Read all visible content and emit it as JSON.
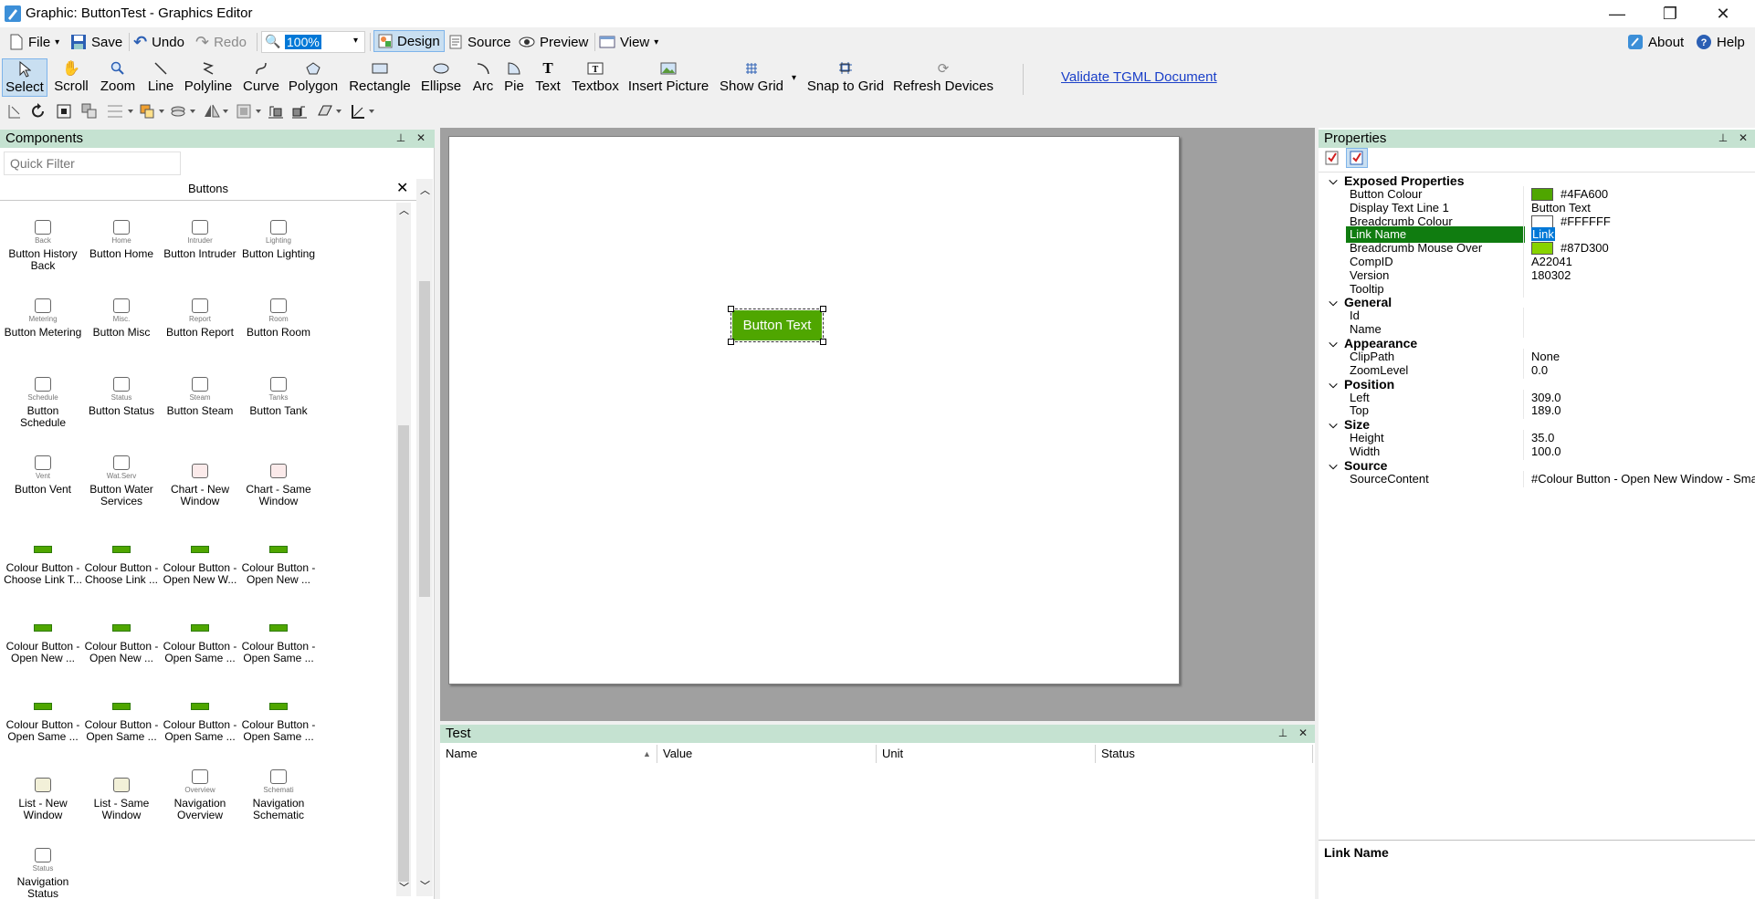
{
  "app": {
    "window_title": "Graphic: ButtonTest - Graphics Editor",
    "controls": {
      "minimize": "—",
      "restore": "❐",
      "close": "✕"
    }
  },
  "menu": {
    "file": "File",
    "save": "Save",
    "undo": "Undo",
    "redo": "Redo",
    "zoom_value": "100%",
    "design": "Design",
    "source": "Source",
    "preview": "Preview",
    "view": "View",
    "about": "About",
    "help": "Help"
  },
  "tools": {
    "select": "Select",
    "scroll": "Scroll",
    "zoom": "Zoom",
    "line": "Line",
    "polyline": "Polyline",
    "curve": "Curve",
    "polygon": "Polygon",
    "rectangle": "Rectangle",
    "ellipse": "Ellipse",
    "arc": "Arc",
    "pie": "Pie",
    "text": "Text",
    "textbox": "Textbox",
    "insert_picture": "Insert Picture",
    "show_grid": "Show Grid",
    "snap_to_grid": "Snap to Grid",
    "refresh_devices": "Refresh Devices",
    "validate_link": "Validate TGML Document"
  },
  "components": {
    "title": "Components",
    "filter_placeholder": "Quick Filter",
    "group_title": "Buttons",
    "items": [
      {
        "label": "Button History Back",
        "caption": "Back",
        "icon": "back-arrow-icon"
      },
      {
        "label": "Button Home",
        "caption": "Home",
        "icon": "home-icon"
      },
      {
        "label": "Button Intruder",
        "caption": "Intruder",
        "icon": "intruder-icon"
      },
      {
        "label": "Button Lighting",
        "caption": "Lighting",
        "icon": "bulb-icon"
      },
      {
        "label": "Button Metering",
        "caption": "Metering",
        "icon": "meter-icon"
      },
      {
        "label": "Button Misc",
        "caption": "Misc.",
        "icon": "folder-icon"
      },
      {
        "label": "Button Report",
        "caption": "Report",
        "icon": "report-icon"
      },
      {
        "label": "Button Room",
        "caption": "Room",
        "icon": "room-icon"
      },
      {
        "label": "Button Schedule",
        "caption": "Schedule",
        "icon": "schedule-icon"
      },
      {
        "label": "Button Status",
        "caption": "Status",
        "icon": "status-icon"
      },
      {
        "label": "Button Steam",
        "caption": "Steam",
        "icon": "steam-icon"
      },
      {
        "label": "Button Tank",
        "caption": "Tanks",
        "icon": "tank-icon"
      },
      {
        "label": "Button Vent",
        "caption": "Vent",
        "icon": "fan-icon"
      },
      {
        "label": "Button Water Services",
        "caption": "Wat.Serv",
        "icon": "tap-icon"
      },
      {
        "label": "Chart - New Window",
        "caption": "",
        "icon": "chart-icon"
      },
      {
        "label": "Chart - Same Window",
        "caption": "",
        "icon": "chart-icon"
      },
      {
        "label": "Colour Button - Choose Link T...",
        "caption": "",
        "icon": "mini-button-icon"
      },
      {
        "label": "Colour Button - Choose Link ...",
        "caption": "",
        "icon": "mini-button-icon"
      },
      {
        "label": "Colour Button - Open New W...",
        "caption": "",
        "icon": "mini-button-icon"
      },
      {
        "label": "Colour Button - Open New ...",
        "caption": "",
        "icon": "mini-button-icon"
      },
      {
        "label": "Colour Button - Open New ...",
        "caption": "",
        "icon": "mini-button-icon"
      },
      {
        "label": "Colour Button - Open New ...",
        "caption": "",
        "icon": "mini-button-icon"
      },
      {
        "label": "Colour Button - Open Same ...",
        "caption": "",
        "icon": "mini-button-icon"
      },
      {
        "label": "Colour Button - Open Same ...",
        "caption": "",
        "icon": "mini-button-icon"
      },
      {
        "label": "Colour Button - Open Same ...",
        "caption": "",
        "icon": "mini-button-icon"
      },
      {
        "label": "Colour Button - Open Same ...",
        "caption": "",
        "icon": "mini-button-icon"
      },
      {
        "label": "Colour Button - Open Same ...",
        "caption": "",
        "icon": "mini-button-icon"
      },
      {
        "label": "Colour Button - Open Same ...",
        "caption": "",
        "icon": "mini-button-icon"
      },
      {
        "label": "List - New Window",
        "caption": "",
        "icon": "list-icon"
      },
      {
        "label": "List - Same Window",
        "caption": "",
        "icon": "list-icon"
      },
      {
        "label": "Navigation Overview",
        "caption": "Overview",
        "icon": "overview-icon"
      },
      {
        "label": "Navigation Schematic",
        "caption": "Schemati",
        "icon": "schematic-icon"
      },
      {
        "label": "Navigation Status",
        "caption": "Status",
        "icon": "nav-status-icon"
      }
    ]
  },
  "canvas": {
    "button_text": "Button Text",
    "button_color": "#4FA600"
  },
  "test_panel": {
    "title": "Test",
    "columns": [
      "Name",
      "Value",
      "Unit",
      "Status"
    ]
  },
  "properties": {
    "title": "Properties",
    "rows": [
      {
        "kind": "cat",
        "name": "Exposed Properties"
      },
      {
        "kind": "prop",
        "name": "Button Colour",
        "value": "#4FA600",
        "swatch": "#4FA600"
      },
      {
        "kind": "prop",
        "name": "Display Text Line 1",
        "value": "Button Text"
      },
      {
        "kind": "prop",
        "name": "Breadcrumb Colour",
        "value": "#FFFFFF",
        "swatch": "#FFFFFF"
      },
      {
        "kind": "prop",
        "name": "Link Name",
        "value": "Link",
        "selected": true
      },
      {
        "kind": "prop",
        "name": "Breadcrumb Mouse Over",
        "value": "#87D300",
        "swatch": "#87D300"
      },
      {
        "kind": "prop",
        "name": "CompID",
        "value": "A22041"
      },
      {
        "kind": "prop",
        "name": "Version",
        "value": "180302"
      },
      {
        "kind": "prop",
        "name": "Tooltip",
        "value": ""
      },
      {
        "kind": "cat",
        "name": "General"
      },
      {
        "kind": "prop",
        "name": "Id",
        "value": ""
      },
      {
        "kind": "prop",
        "name": "Name",
        "value": ""
      },
      {
        "kind": "cat",
        "name": "Appearance"
      },
      {
        "kind": "prop",
        "name": "ClipPath",
        "value": "None"
      },
      {
        "kind": "prop",
        "name": "ZoomLevel",
        "value": "0.0"
      },
      {
        "kind": "cat",
        "name": "Position"
      },
      {
        "kind": "prop",
        "name": "Left",
        "value": "309.0"
      },
      {
        "kind": "prop",
        "name": "Top",
        "value": "189.0"
      },
      {
        "kind": "cat",
        "name": "Size"
      },
      {
        "kind": "prop",
        "name": "Height",
        "value": "35.0"
      },
      {
        "kind": "prop",
        "name": "Width",
        "value": "100.0"
      },
      {
        "kind": "cat",
        "name": "Source"
      },
      {
        "kind": "prop",
        "name": "SourceContent",
        "value": "#Colour Button - Open New Window - Smal"
      }
    ],
    "description_title": "Link Name"
  }
}
